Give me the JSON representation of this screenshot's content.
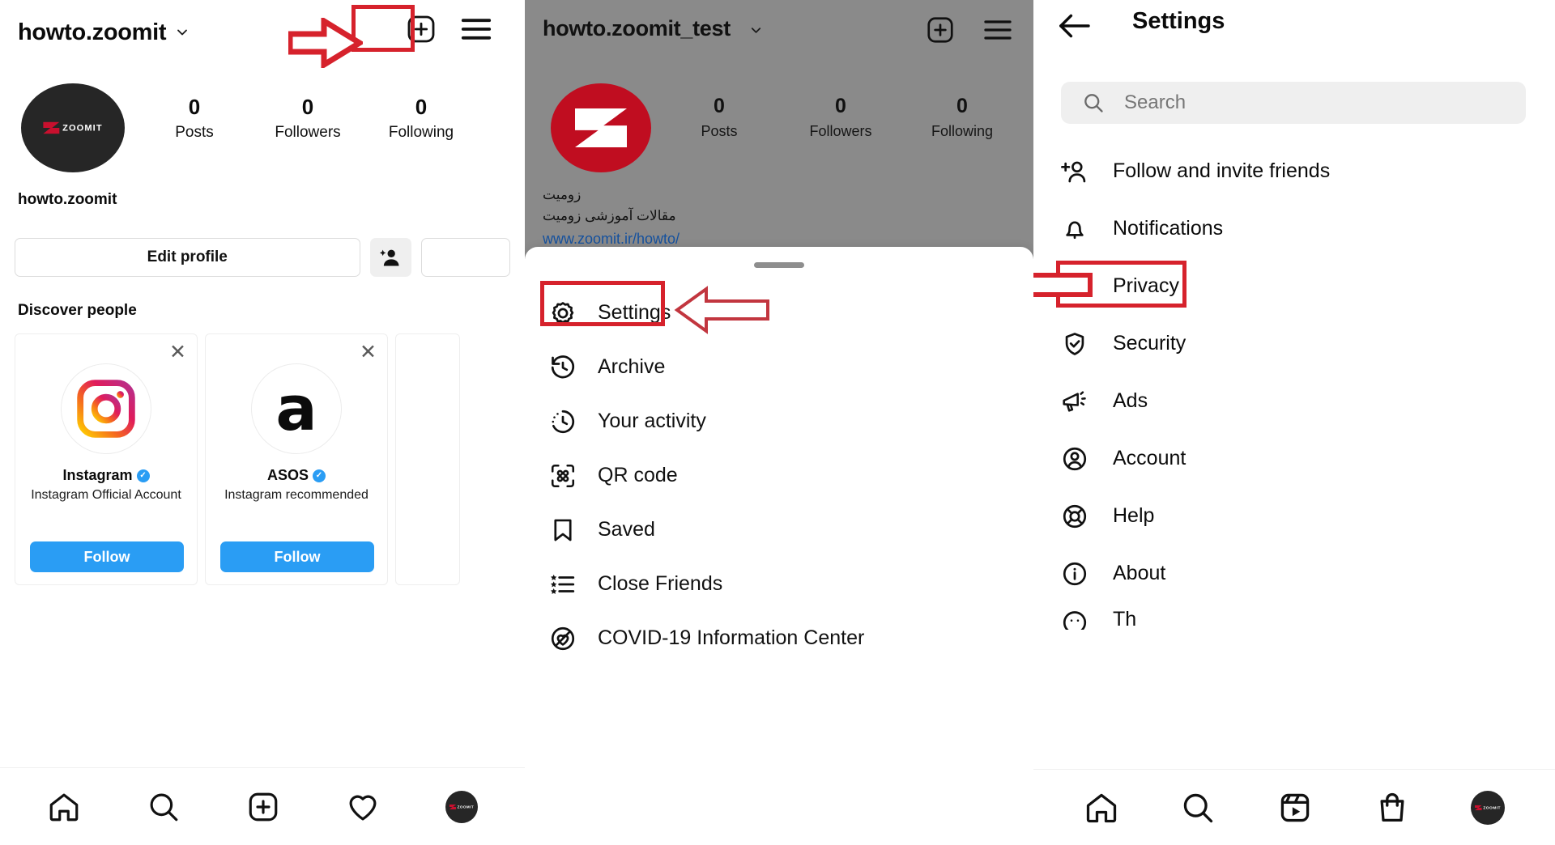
{
  "panel1": {
    "username": "howto.zoomit",
    "chevron_icon": "chevron-down-icon",
    "add_icon": "add-post-icon",
    "menu_icon": "hamburger-menu-icon",
    "display_name": "howto.zoomit",
    "avatar_word": "ZOOMIT",
    "stats": [
      {
        "value": "0",
        "label": "Posts"
      },
      {
        "value": "0",
        "label": "Followers"
      },
      {
        "value": "0",
        "label": "Following"
      }
    ],
    "edit_profile_label": "Edit profile",
    "add_user_icon": "add-person-icon",
    "discover_title": "Discover people",
    "cards": [
      {
        "name": "Instagram",
        "verified_badge": "✓",
        "subtitle": "Instagram Official Account",
        "follow_label": "Follow",
        "close_icon": "close-icon",
        "avatar_icon": "instagram-logo-icon"
      },
      {
        "name": "ASOS",
        "verified_badge": "✓",
        "subtitle": "Instagram recommended",
        "follow_label": "Follow",
        "close_icon": "close-icon",
        "avatar_icon": "asos-logo-icon"
      }
    ],
    "nav": [
      "home-icon",
      "search-icon",
      "add-post-icon",
      "heart-icon",
      "profile-avatar-icon"
    ]
  },
  "panel2": {
    "username": "howto.zoomit_test",
    "chevron_icon": "chevron-down-icon",
    "add_icon": "add-post-icon",
    "menu_icon": "hamburger-menu-icon",
    "stats": [
      {
        "value": "0",
        "label": "Posts"
      },
      {
        "value": "0",
        "label": "Followers"
      },
      {
        "value": "0",
        "label": "Following"
      }
    ],
    "bio_line1": "زومیت",
    "bio_line2": "مقالات آموزشی زومیت",
    "website": "www.zoomit.ir/howto/",
    "menu_items": [
      {
        "label": "Settings",
        "icon": "gear-icon"
      },
      {
        "label": "Archive",
        "icon": "archive-clock-icon"
      },
      {
        "label": "Your activity",
        "icon": "activity-clock-icon"
      },
      {
        "label": "QR code",
        "icon": "qr-code-icon"
      },
      {
        "label": "Saved",
        "icon": "bookmark-icon"
      },
      {
        "label": "Close Friends",
        "icon": "close-friends-list-icon"
      },
      {
        "label": "COVID-19 Information Center",
        "icon": "covid-info-icon"
      }
    ]
  },
  "panel3": {
    "back_icon": "back-arrow-icon",
    "title": "Settings",
    "search_placeholder": "Search",
    "search_icon": "search-icon",
    "items": [
      {
        "label": "Follow and invite friends",
        "icon": "add-person-icon"
      },
      {
        "label": "Notifications",
        "icon": "bell-icon"
      },
      {
        "label": "Privacy",
        "icon": "lock-icon"
      },
      {
        "label": "Security",
        "icon": "shield-check-icon"
      },
      {
        "label": "Ads",
        "icon": "megaphone-icon"
      },
      {
        "label": "Account",
        "icon": "account-circle-icon"
      },
      {
        "label": "Help",
        "icon": "lifebuoy-icon"
      },
      {
        "label": "About",
        "icon": "info-circle-icon"
      }
    ],
    "cut_item": {
      "label": "Th",
      "icon": "theme-icon"
    },
    "nav": [
      "home-icon",
      "search-icon",
      "reels-icon",
      "shop-bag-icon",
      "profile-avatar-icon"
    ]
  },
  "annotations": {
    "accent_color": "#d6222c",
    "highlight_menu_button": "hamburger-menu-highlight",
    "highlight_settings_item": "settings-item-highlight",
    "highlight_privacy_item": "privacy-item-highlight",
    "arrow_to_menu": "red-arrow-right",
    "arrow_to_settings": "red-arrow-left",
    "arrow_to_privacy": "red-arrow-left"
  }
}
